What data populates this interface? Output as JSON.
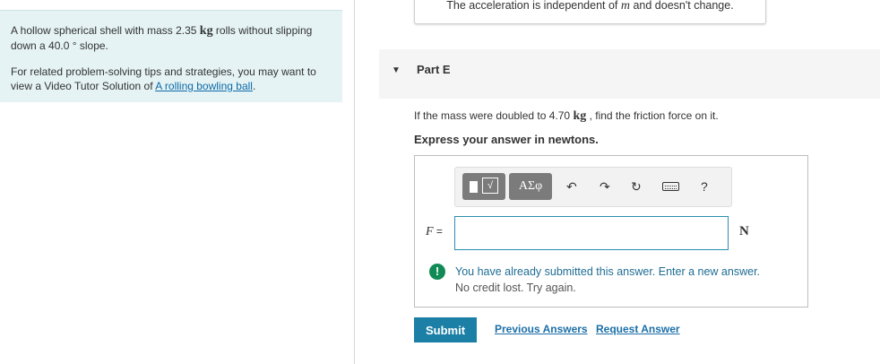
{
  "problem": {
    "line1_pre": "A hollow spherical shell with mass 2.35 ",
    "mass_unit": "kg",
    "line1_post": " rolls without slipping down a 40.0 ° slope.",
    "line2_pre": "For related problem-solving tips and strategies, you may want to view a Video Tutor Solution of ",
    "link_text": "A rolling bowling ball",
    "line2_post": "."
  },
  "previous_feedback": {
    "pre": "The acceleration is independent of ",
    "var": "m",
    "post": " and doesn't change."
  },
  "part": {
    "title": "Part E",
    "question_pre": "If the mass were doubled to 4.70 ",
    "question_unit": "kg",
    "question_post": " , find the friction force on it.",
    "instruction": "Express your answer in newtons."
  },
  "toolbar": {
    "template_label": "√□",
    "greek_label": "ΑΣφ",
    "undo_icon": "undo-icon",
    "redo_icon": "redo-icon",
    "reset_icon": "reset-icon",
    "keyboard_icon": "keyboard-icon",
    "help_label": "?"
  },
  "answer": {
    "variable": "F",
    "equals": " =",
    "value": "",
    "unit": "N"
  },
  "warning": {
    "main": "You have already submitted this answer. Enter a new answer.",
    "sub": "No credit lost. Try again."
  },
  "actions": {
    "submit": "Submit",
    "previous_answers": "Previous Answers",
    "request_answer": "Request Answer"
  },
  "colors": {
    "accent": "#1b7fa6",
    "problem_bg": "#e5f3f4",
    "warning_icon": "#108b55"
  }
}
